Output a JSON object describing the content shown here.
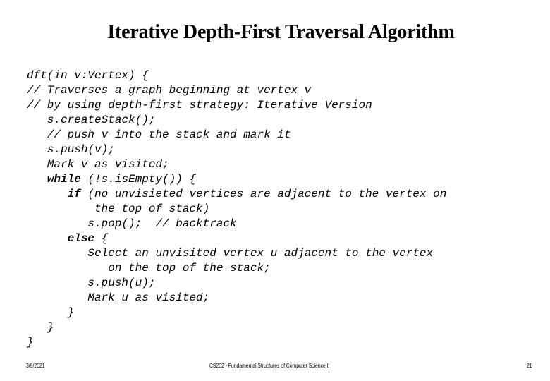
{
  "slide": {
    "title": "Iterative Depth-First Traversal Algorithm",
    "code_lines": [
      {
        "indent": 0,
        "keyword": "",
        "text": "dft(in v:Vertex) {"
      },
      {
        "indent": 0,
        "keyword": "",
        "text": "// Traverses a graph beginning at vertex v"
      },
      {
        "indent": 0,
        "keyword": "",
        "text": "// by using depth-first strategy: Iterative Version"
      },
      {
        "indent": 3,
        "keyword": "",
        "text": "s.createStack();"
      },
      {
        "indent": 3,
        "keyword": "",
        "text": "// push v into the stack and mark it"
      },
      {
        "indent": 3,
        "keyword": "",
        "text": "s.push(v);"
      },
      {
        "indent": 3,
        "keyword": "",
        "text": "Mark v as visited;"
      },
      {
        "indent": 3,
        "keyword": "while",
        "text": " (!s.isEmpty()) {"
      },
      {
        "indent": 6,
        "keyword": "if",
        "text": " (no unvisieted vertices are adjacent to the vertex on"
      },
      {
        "indent": 10,
        "keyword": "",
        "text": "the top of stack)"
      },
      {
        "indent": 9,
        "keyword": "",
        "text": "s.pop();  // backtrack"
      },
      {
        "indent": 6,
        "keyword": "else",
        "text": " {"
      },
      {
        "indent": 9,
        "keyword": "",
        "text": "Select an unvisited vertex u adjacent to the vertex"
      },
      {
        "indent": 12,
        "keyword": "",
        "text": "on the top of the stack;"
      },
      {
        "indent": 9,
        "keyword": "",
        "text": "s.push(u);"
      },
      {
        "indent": 9,
        "keyword": "",
        "text": "Mark u as visited;"
      },
      {
        "indent": 6,
        "keyword": "",
        "text": "}"
      },
      {
        "indent": 3,
        "keyword": "",
        "text": "}"
      },
      {
        "indent": 0,
        "keyword": "",
        "text": "}"
      }
    ]
  },
  "footer": {
    "date": "3/9/2021",
    "course": "CS202 - Fundamental Structures of Computer Science II",
    "page_number": "21"
  }
}
